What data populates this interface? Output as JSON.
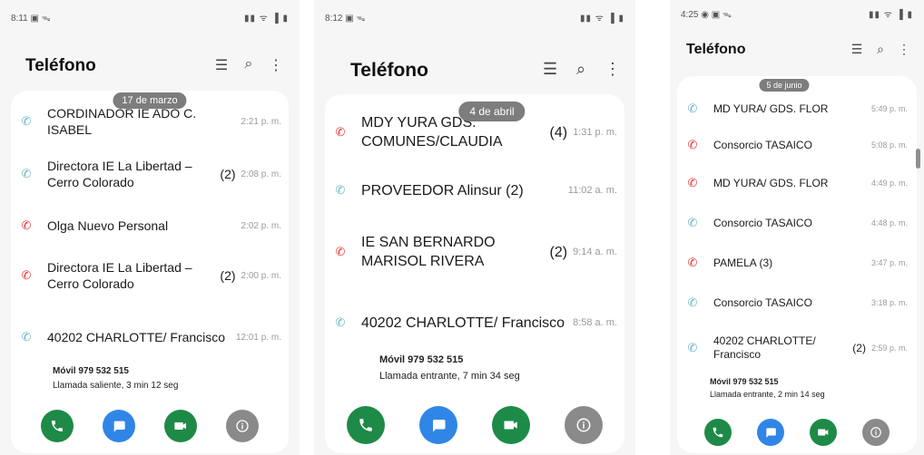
{
  "colors": {
    "call": "#1e8a47",
    "message": "#2f86e6",
    "video": "#1e8a47",
    "info": "#8a8a8a",
    "missed": "#e53935",
    "incoming": "#6fb3c9"
  },
  "screens": [
    {
      "status_time": "8:11 ▣ ᯓ",
      "status_icons": "▮▮ ᯤ ▐ ▮",
      "title": "Teléfono",
      "date_pill": "17 de marzo",
      "calls": [
        {
          "type": "incoming",
          "name": "CORDINADOR IE ADO C. ISABEL",
          "count": "",
          "time": "2:21 p. m."
        },
        {
          "type": "incoming",
          "name": "Directora IE La Libertad – Cerro Colorado",
          "count": "(2)",
          "time": "2:08 p. m."
        },
        {
          "type": "missed",
          "name": "Olga Nuevo Personal",
          "count": "",
          "time": "2:02 p. m."
        },
        {
          "type": "missed",
          "name": "Directora IE La Libertad – Cerro Colorado",
          "count": "(2)",
          "time": "2:00 p. m."
        },
        {
          "type": "incoming",
          "name": "40202 CHARLOTTE/ Francisco",
          "count": "",
          "time": "12:01 p. m."
        }
      ],
      "detail_number": "Móvil 979 532 515",
      "detail_info": "Llamada saliente, 3 min 12 seg"
    },
    {
      "status_time": "8:12 ▣ ᯓ",
      "status_icons": "▮▮ ᯤ ▐ ▮",
      "title": "Teléfono",
      "date_pill": "4 de abril",
      "calls": [
        {
          "type": "missed",
          "name": "MDY YURA GDS. COMUNES/CLAUDIA",
          "count": "(4)",
          "time": "1:31 p. m."
        },
        {
          "type": "incoming",
          "name": "PROVEEDOR Alinsur (2)",
          "count": "",
          "time": "11:02 a. m."
        },
        {
          "type": "missed",
          "name": "IE SAN BERNARDO MARISOL RIVERA",
          "count": "(2)",
          "time": "9:14 a. m."
        },
        {
          "type": "incoming",
          "name": "40202 CHARLOTTE/ Francisco",
          "count": "",
          "time": "8:58 a. m."
        }
      ],
      "detail_number": "Móvil 979 532 515",
      "detail_info": "Llamada entrante, 7 min 34 seg"
    },
    {
      "status_time": "4:25 ◉ ▣ ᯓ",
      "status_icons": "▮▮ ᯤ ▐ ▮",
      "title": "Teléfono",
      "date_pill": "5 de junio",
      "calls": [
        {
          "type": "incoming",
          "name": "MD YURA/ GDS. FLOR",
          "count": "",
          "time": "5:49 p. m."
        },
        {
          "type": "missed",
          "name": "Consorcio TASAICO",
          "count": "",
          "time": "5:08 p. m."
        },
        {
          "type": "missed",
          "name": "MD YURA/ GDS. FLOR",
          "count": "",
          "time": "4:49 p. m."
        },
        {
          "type": "incoming",
          "name": "Consorcio TASAICO",
          "count": "",
          "time": "4:48 p. m."
        },
        {
          "type": "missed",
          "name": "PAMELA (3)",
          "count": "",
          "time": "3:47 p. m."
        },
        {
          "type": "incoming",
          "name": "Consorcio TASAICO",
          "count": "",
          "time": "3:18 p. m."
        },
        {
          "type": "incoming",
          "name": "40202 CHARLOTTE/ Francisco",
          "count": "(2)",
          "time": "2:59 p. m."
        }
      ],
      "detail_number": "Móvil 979 532 515",
      "detail_info": "Llamada entrante, 2 min 14 seg"
    }
  ]
}
